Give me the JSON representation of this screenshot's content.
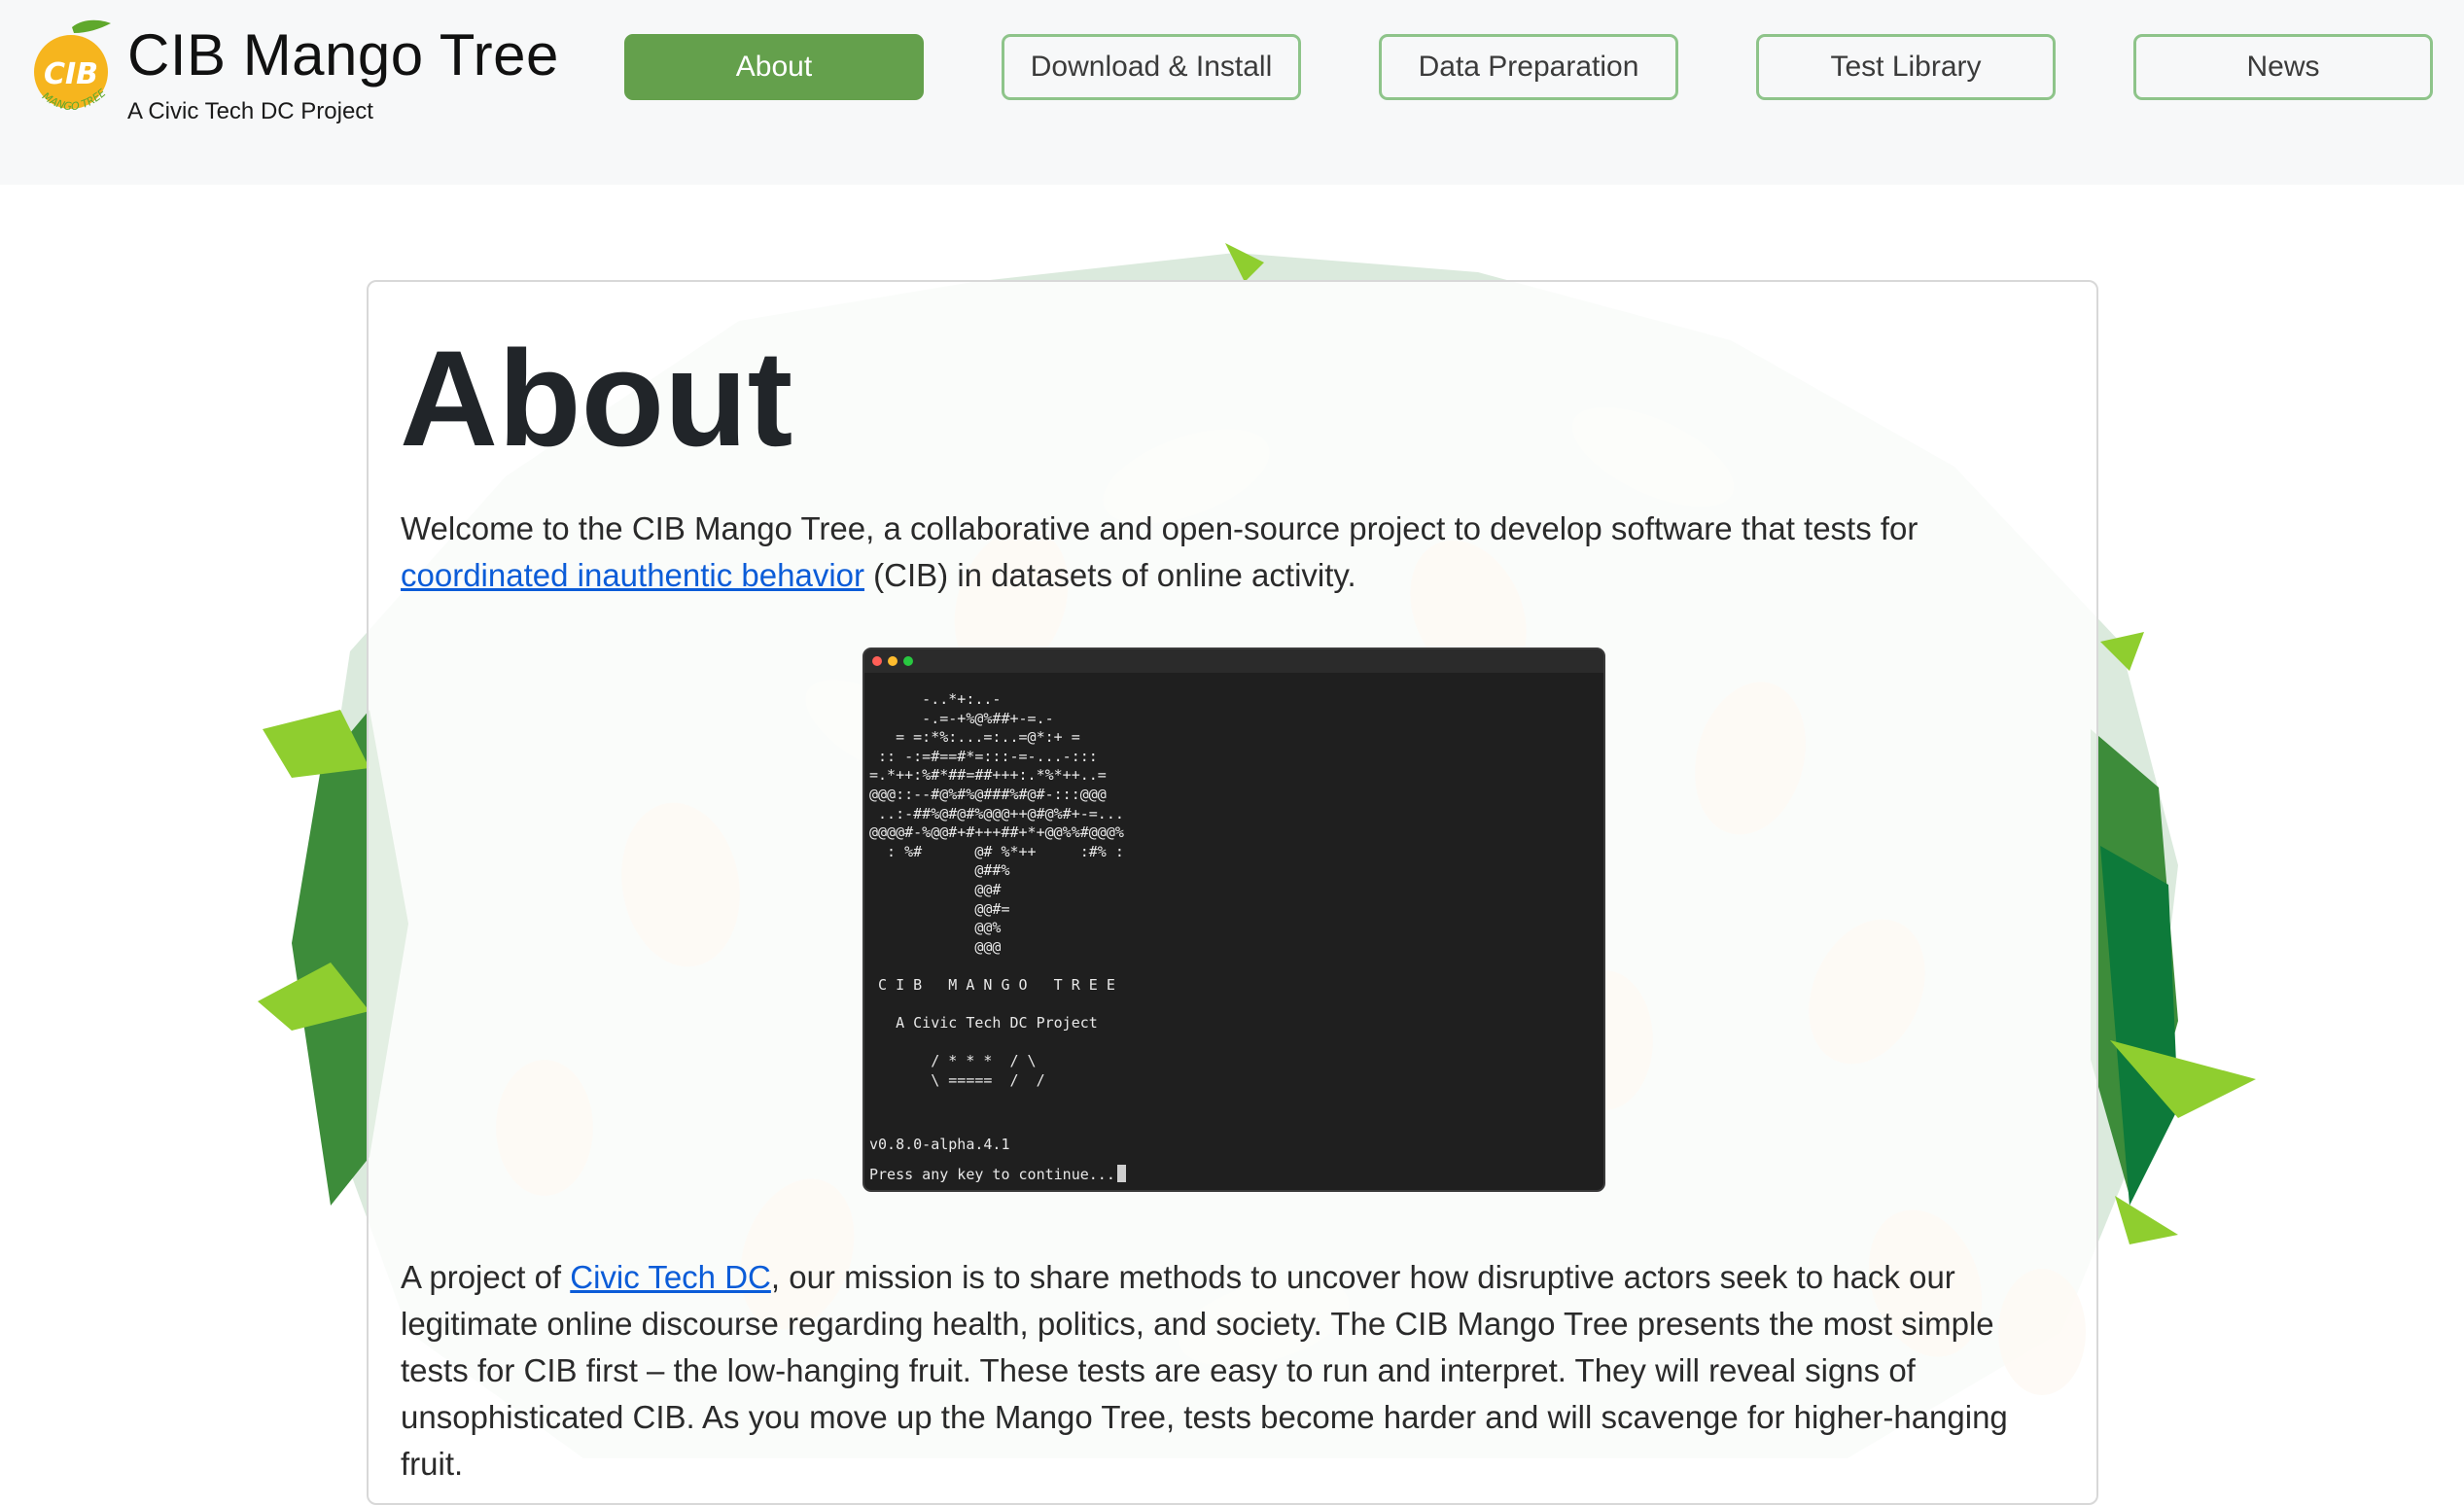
{
  "brand": {
    "title": "CIB Mango Tree",
    "subtitle": "A Civic Tech DC Project",
    "logo_text": "CIB",
    "logo_ring_text": "MANGO TREE"
  },
  "nav": [
    {
      "label": "About",
      "active": true
    },
    {
      "label": "Download & Install",
      "active": false
    },
    {
      "label": "Data Preparation",
      "active": false
    },
    {
      "label": "Test Library",
      "active": false
    },
    {
      "label": "News",
      "active": false
    }
  ],
  "main": {
    "title": "About",
    "intro": {
      "before": "Welcome to the CIB Mango Tree, a collaborative and open-source project to develop software that tests for ",
      "link": "coordinated inauthentic behavior",
      "after": " (CIB) in datasets of online activity."
    },
    "mission": {
      "before": "A project of ",
      "link": "Civic Tech DC",
      "after": ", our mission is to share methods to uncover how disruptive actors seek to hack our legitimate online discourse regarding health, politics, and society. The CIB Mango Tree presents the most simple tests for CIB first – the low-hanging fruit. These tests are easy to run and interpret. They will reveal signs of unsophisticated CIB. As you move up the Mango Tree, tests become harder and will scavenge for higher-hanging fruit."
    }
  },
  "terminal": {
    "art": "      -..*+:..-\n      -.=-+%@%##+-=.-\n   = =:*%:...=:..=@*:+ =\n :: -:=#==#*=:::-=-...-:::\n=.*++:%#*##=##+++:.*%*++..=\n@@@::--#@%#%@###%#@#-:::@@@\n ..:-##%@#@#%@@@++@#@%#+-=...\n@@@@#-%@@#+#+++##+*+@@%%#@@@%\n  : %#      @# %*++     :#% :\n            @##%\n            @@#\n            @@#=\n            @@%\n            @@@\n\n C I B   M A N G O   T R E E\n\n   A Civic Tech DC Project\n\n       / * * *  / \\\n       \\ =====  /  /",
    "version": "v0.8.0-alpha.4.1",
    "prompt": "Press any key to continue..."
  },
  "colors": {
    "active_nav": "#64a04c",
    "nav_border": "#8ec48a",
    "link": "#0b5cd8",
    "terminal_bg": "#1f1f1f"
  }
}
